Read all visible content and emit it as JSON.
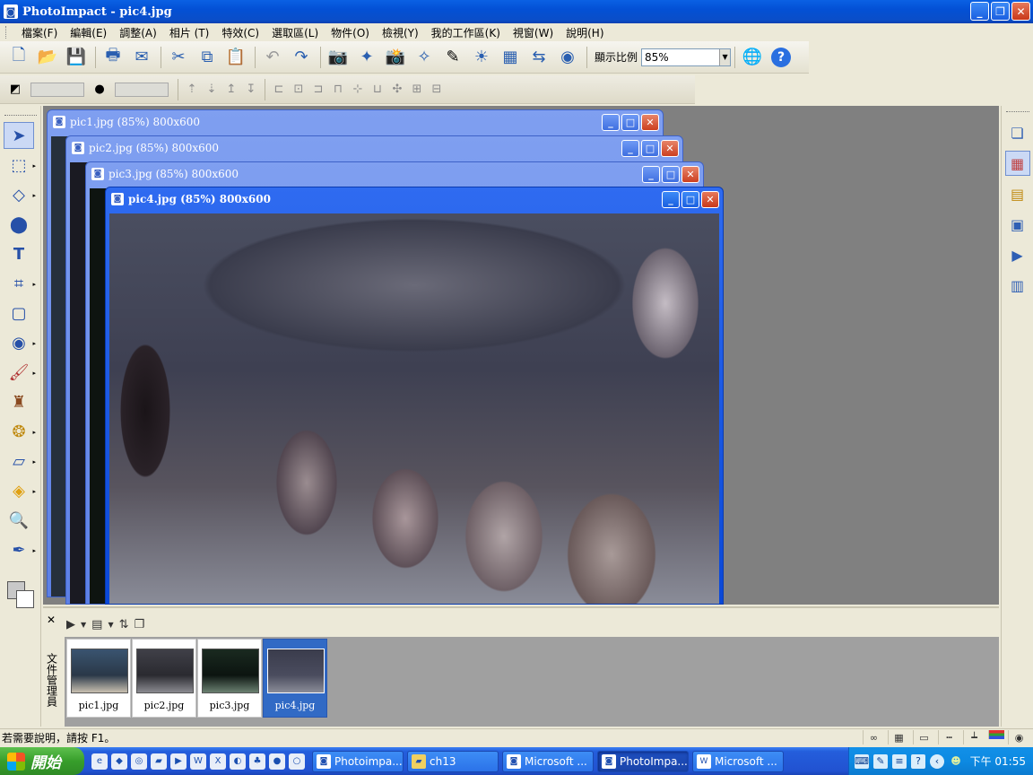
{
  "app": {
    "title": "PhotoImpact - pic4.jpg"
  },
  "menu": [
    "檔案(F)",
    "編輯(E)",
    "調整(A)",
    "相片 (T)",
    "特效(C)",
    "選取區(L)",
    "物件(O)",
    "檢視(Y)",
    "我的工作區(K)",
    "視窗(W)",
    "說明(H)"
  ],
  "toolbar": {
    "zoom_label": "顯示比例",
    "zoom_value": "85%"
  },
  "documents": [
    {
      "title": "pic1.jpg (85%) 800x600"
    },
    {
      "title": "pic2.jpg (85%) 800x600"
    },
    {
      "title": "pic3.jpg (85%) 800x600"
    },
    {
      "title": "pic4.jpg (85%) 800x600"
    }
  ],
  "docmgr": {
    "side_label": "文件管理員",
    "thumbnails": [
      "pic1.jpg",
      "pic2.jpg",
      "pic3.jpg",
      "pic4.jpg"
    ],
    "selected": "pic4.jpg"
  },
  "status": {
    "message": "若需要說明，請按 F1。"
  },
  "taskbar": {
    "start_label": "開始",
    "tasks": [
      "Photoimpa...",
      "ch13",
      "Microsoft ...",
      "PhotoImpa...",
      "Microsoft ..."
    ],
    "active_task": "PhotoImpa...",
    "clock": "下午 01:55"
  }
}
